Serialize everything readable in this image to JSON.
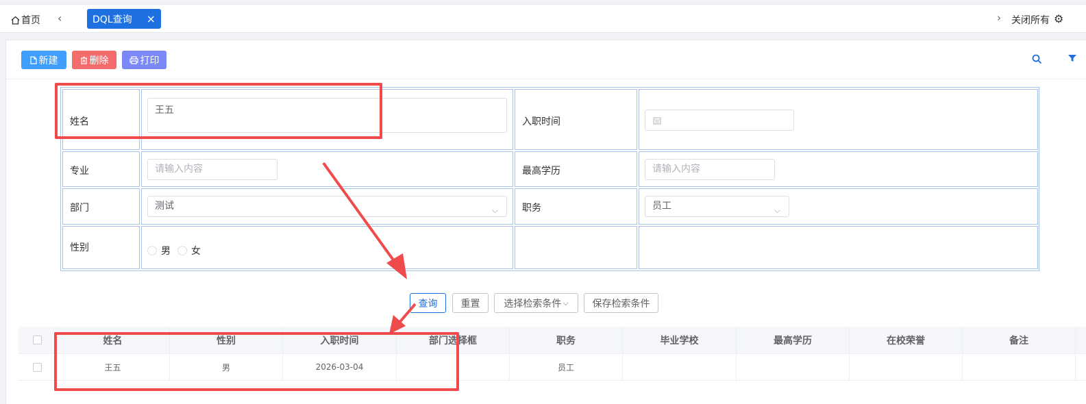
{
  "topbar": {
    "home_label": "首页",
    "tab_label": "DQL查询",
    "close_all_label": "关闭所有"
  },
  "toolbar": {
    "new_label": "新建",
    "delete_label": "删除",
    "print_label": "打印"
  },
  "form": {
    "name_label": "姓名",
    "name_value": "王五",
    "hire_date_label": "入职时间",
    "major_label": "专业",
    "major_placeholder": "请输入内容",
    "education_label": "最高学历",
    "education_placeholder": "请输入内容",
    "dept_label": "部门",
    "dept_value": "测试",
    "position_label": "职务",
    "position_value": "员工",
    "gender_label": "性别",
    "gender_options": [
      "男",
      "女"
    ]
  },
  "search_buttons": {
    "query": "查询",
    "reset": "重置",
    "choose_conditions": "选择检索条件",
    "save_conditions": "保存检索条件"
  },
  "table": {
    "columns": [
      "姓名",
      "性别",
      "入职时间",
      "部门选择框",
      "职务",
      "毕业学校",
      "最高学历",
      "在校荣誉",
      "备注"
    ],
    "rows": [
      [
        "王五",
        "男",
        "2026-03-04",
        "",
        "员工",
        "",
        "",
        "",
        ""
      ]
    ]
  },
  "colors": {
    "primary": "#1e6fe0",
    "danger": "#f56c6c",
    "annotation": "#ef4b4b"
  }
}
